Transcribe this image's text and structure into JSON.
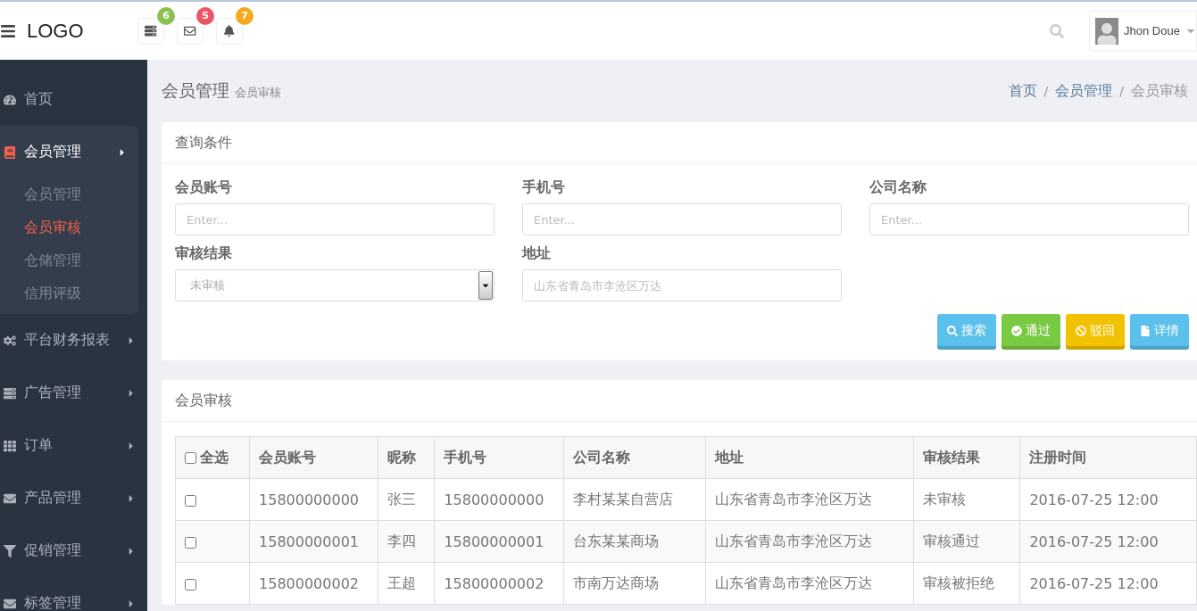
{
  "header": {
    "logo": "LOGO",
    "notifications": [
      {
        "count": "6",
        "color": "#8cc152"
      },
      {
        "count": "5",
        "color": "#ed5565"
      },
      {
        "count": "7",
        "color": "#f6a821"
      }
    ],
    "user": {
      "name": "Jhon Doue"
    }
  },
  "sidebar": {
    "items": [
      {
        "label": "首页",
        "has_arrow": false,
        "expanded": false
      },
      {
        "label": "会员管理",
        "has_arrow": true,
        "expanded": true,
        "children": [
          {
            "label": "会员管理",
            "selected": false
          },
          {
            "label": "会员审核",
            "selected": true
          },
          {
            "label": "仓储管理",
            "selected": false
          },
          {
            "label": "信用评级",
            "selected": false
          }
        ]
      },
      {
        "label": "平台财务报表",
        "has_arrow": true,
        "expanded": false
      },
      {
        "label": "广告管理",
        "has_arrow": true,
        "expanded": false
      },
      {
        "label": "订单",
        "has_arrow": true,
        "expanded": false
      },
      {
        "label": "产品管理",
        "has_arrow": true,
        "expanded": false
      },
      {
        "label": "促销管理",
        "has_arrow": true,
        "expanded": false
      },
      {
        "label": "标签管理",
        "has_arrow": true,
        "expanded": false
      }
    ]
  },
  "page_header": {
    "title": "会员管理",
    "subtitle": "会员审核",
    "breadcrumb": {
      "items": [
        "首页",
        "会员管理",
        "会员审核"
      ],
      "separators": [
        "/",
        "/"
      ]
    }
  },
  "query_panel": {
    "title": "查询条件",
    "fields": [
      {
        "kind": "text",
        "label": "会员账号",
        "placeholder": "Enter..."
      },
      {
        "kind": "text",
        "label": "手机号",
        "placeholder": "Enter..."
      },
      {
        "kind": "text",
        "label": "公司名称",
        "placeholder": "Enter..."
      },
      {
        "kind": "select",
        "label": "审核结果",
        "value": "未审核"
      },
      {
        "kind": "text",
        "label": "地址",
        "placeholder": "山东省青岛市李沧区万达"
      }
    ],
    "buttons": [
      {
        "label": "搜索",
        "color": "#5bc0eb"
      },
      {
        "label": "通过",
        "color": "#7ac943"
      },
      {
        "label": "驳回",
        "color": "#f2c200"
      },
      {
        "label": "详情",
        "color": "#5bc0eb"
      }
    ]
  },
  "table_panel": {
    "title": "会员审核",
    "select_all": {
      "label": "全选",
      "checked": false
    },
    "columns": [
      "会员账号",
      "昵称",
      "手机号",
      "公司名称",
      "地址",
      "审核结果",
      "注册时间"
    ],
    "rows": [
      {
        "checked": false,
        "cells": [
          "15800000000",
          "张三",
          "15800000000",
          "李村某某自营店",
          "山东省青岛市李沧区万达",
          "未审核",
          "2016-07-25 12:00"
        ]
      },
      {
        "checked": false,
        "cells": [
          "15800000001",
          "李四",
          "15800000001",
          "台东某某商场",
          "山东省青岛市李沧区万达",
          "审核通过",
          "2016-07-25 12:00"
        ]
      },
      {
        "checked": false,
        "cells": [
          "15800000002",
          "王超",
          "15800000002",
          "市南万达商场",
          "山东省青岛市李沧区万达",
          "审核被拒绝",
          "2016-07-25 12:00"
        ]
      }
    ]
  }
}
